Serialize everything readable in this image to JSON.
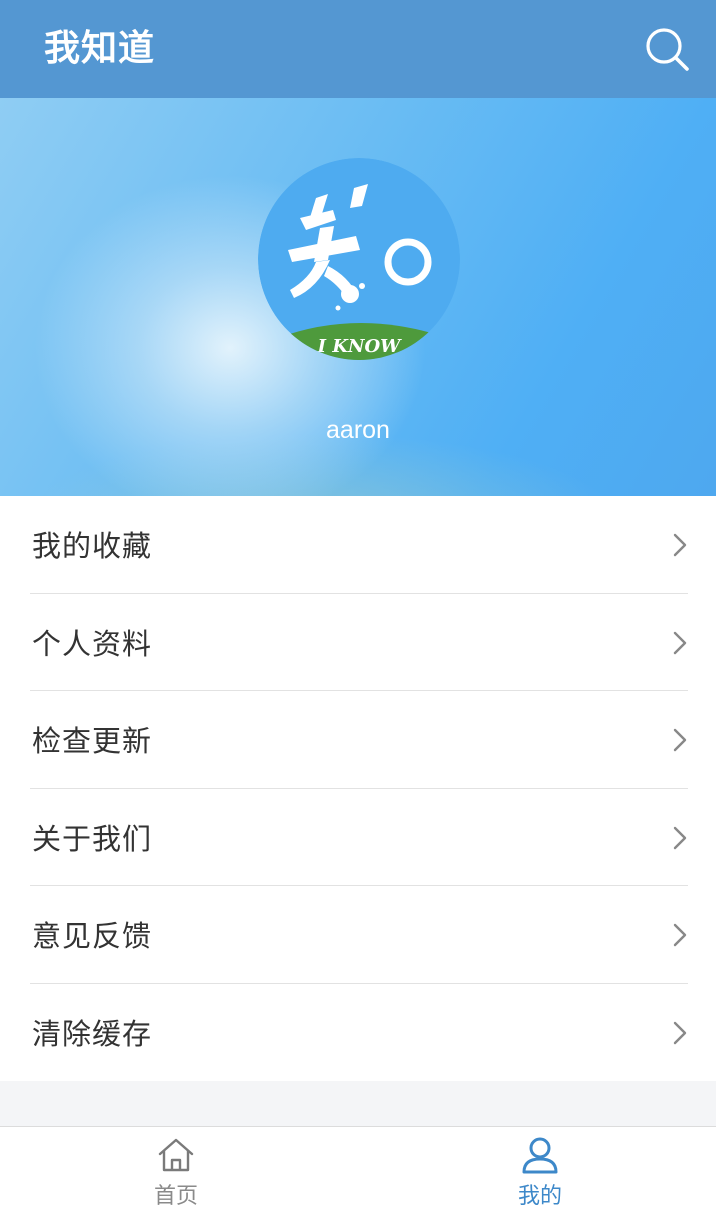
{
  "header": {
    "title": "我知道",
    "search_icon": "search-icon"
  },
  "profile": {
    "avatar_logo_text": "I KNOW",
    "username": "aaron"
  },
  "menu": {
    "items": [
      {
        "label": "我的收藏",
        "icon": "chevron-right-icon"
      },
      {
        "label": "个人资料",
        "icon": "chevron-right-icon"
      },
      {
        "label": "检查更新",
        "icon": "chevron-right-icon"
      },
      {
        "label": "关于我们",
        "icon": "chevron-right-icon"
      },
      {
        "label": "意见反馈",
        "icon": "chevron-right-icon"
      },
      {
        "label": "清除缓存",
        "icon": "chevron-right-icon"
      }
    ]
  },
  "tabbar": {
    "tabs": [
      {
        "label": "首页",
        "icon": "home-icon",
        "active": false
      },
      {
        "label": "我的",
        "icon": "user-icon",
        "active": true
      }
    ]
  },
  "colors": {
    "header_bg": "#5497d2",
    "accent": "#3d88c9",
    "inactive_tab": "#8a8a8a",
    "text": "#333333"
  }
}
